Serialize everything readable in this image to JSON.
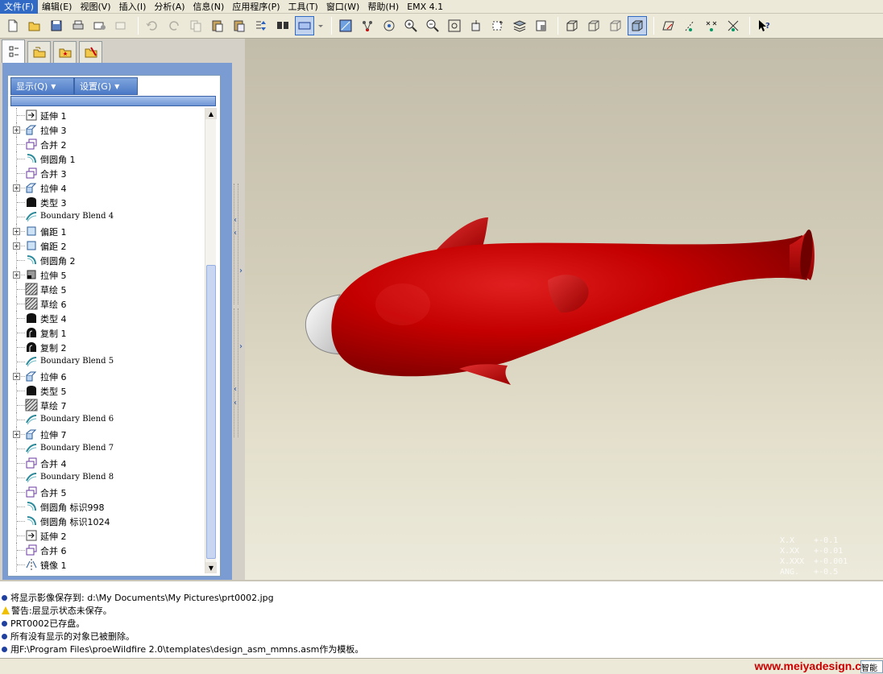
{
  "menu": {
    "items": [
      {
        "label": "文件(F)"
      },
      {
        "label": "编辑(E)"
      },
      {
        "label": "视图(V)"
      },
      {
        "label": "插入(I)"
      },
      {
        "label": "分析(A)"
      },
      {
        "label": "信息(N)"
      },
      {
        "label": "应用程序(P)"
      },
      {
        "label": "工具(T)"
      },
      {
        "label": "窗口(W)"
      },
      {
        "label": "帮助(H)"
      },
      {
        "label": "EMX 4.1"
      }
    ]
  },
  "tree": {
    "display_menu": "显示(Q)",
    "settings_menu": "设置(G)",
    "items": [
      {
        "label": "延伸 1",
        "icon": "extend-icon",
        "expandable": false
      },
      {
        "label": "拉伸 3",
        "icon": "extrude-icon",
        "expandable": true
      },
      {
        "label": "合并 2",
        "icon": "merge-icon",
        "expandable": false
      },
      {
        "label": "倒圆角 1",
        "icon": "round-icon",
        "expandable": false
      },
      {
        "label": "合并 3",
        "icon": "merge-icon",
        "expandable": false
      },
      {
        "label": "拉伸 4",
        "icon": "extrude-icon",
        "expandable": true
      },
      {
        "label": "类型 3",
        "icon": "type-icon",
        "expandable": false
      },
      {
        "label": "Boundary Blend 4",
        "icon": "boundary-blend-icon",
        "expandable": false
      },
      {
        "label": "偏距 1",
        "icon": "offset-icon",
        "expandable": true
      },
      {
        "label": "偏距 2",
        "icon": "offset-icon",
        "expandable": true
      },
      {
        "label": "倒圆角 2",
        "icon": "round-icon",
        "expandable": false
      },
      {
        "label": "拉伸 5",
        "icon": "extrude-solid-icon",
        "expandable": true
      },
      {
        "label": "草绘 5",
        "icon": "sketch-icon",
        "expandable": false
      },
      {
        "label": "草绘 6",
        "icon": "sketch-icon",
        "expandable": false
      },
      {
        "label": "类型 4",
        "icon": "type-icon",
        "expandable": false
      },
      {
        "label": "复制 1",
        "icon": "copy-icon",
        "expandable": false
      },
      {
        "label": "复制 2",
        "icon": "copy-icon",
        "expandable": false
      },
      {
        "label": "Boundary Blend 5",
        "icon": "boundary-blend-icon",
        "expandable": false
      },
      {
        "label": "拉伸 6",
        "icon": "extrude-icon",
        "expandable": true
      },
      {
        "label": "类型 5",
        "icon": "type-icon",
        "expandable": false
      },
      {
        "label": "草绘 7",
        "icon": "sketch-icon",
        "expandable": false
      },
      {
        "label": "Boundary Blend 6",
        "icon": "boundary-blend-icon",
        "expandable": false
      },
      {
        "label": "拉伸 7",
        "icon": "extrude-icon",
        "expandable": true
      },
      {
        "label": "Boundary Blend 7",
        "icon": "boundary-blend-icon",
        "expandable": false
      },
      {
        "label": "合并 4",
        "icon": "merge-icon",
        "expandable": false
      },
      {
        "label": "Boundary Blend 8",
        "icon": "boundary-blend-icon",
        "expandable": false
      },
      {
        "label": "合并 5",
        "icon": "merge-icon",
        "expandable": false
      },
      {
        "label": "倒圆角 标识998",
        "icon": "round-icon",
        "expandable": false
      },
      {
        "label": "倒圆角 标识1024",
        "icon": "round-icon",
        "expandable": false
      },
      {
        "label": "延伸 2",
        "icon": "extend-icon",
        "expandable": false
      },
      {
        "label": "合并 6",
        "icon": "merge-icon",
        "expandable": false
      },
      {
        "label": "镜像 1",
        "icon": "mirror-icon",
        "expandable": false
      }
    ]
  },
  "viewport": {
    "model_color": "#c40000",
    "tolerances": [
      "X.X    +-0.1",
      "X.XX   +-0.01",
      "X.XXX  +-0.001",
      "ANG.   +-0.5"
    ]
  },
  "messages": [
    {
      "type": "info",
      "text": "将显示影像保存到: d:\\My Documents\\My Pictures\\prt0002.jpg"
    },
    {
      "type": "warning",
      "text": "警告:层显示状态未保存。"
    },
    {
      "type": "info",
      "text": "PRT0002已存盘。"
    },
    {
      "type": "info",
      "text": "所有没有显示的对象已被删除。"
    },
    {
      "type": "info",
      "text": "用F:\\Program Files\\proeWildfire 2.0\\templates\\design_asm_mmns.asm作为模板。"
    }
  ],
  "status": {
    "watermark": "www.meiyadesign.com",
    "smart_filter": "智能"
  }
}
